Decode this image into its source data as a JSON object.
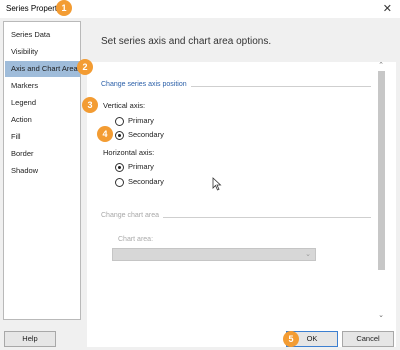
{
  "window": {
    "title": "Series Properties",
    "close_glyph": "✕"
  },
  "sidebar": {
    "items": [
      {
        "label": "Series Data"
      },
      {
        "label": "Visibility"
      },
      {
        "label": "Axis and Chart Area",
        "selected": true
      },
      {
        "label": "Markers"
      },
      {
        "label": "Legend"
      },
      {
        "label": "Action"
      },
      {
        "label": "Fill"
      },
      {
        "label": "Border"
      },
      {
        "label": "Shadow"
      }
    ]
  },
  "content": {
    "header": "Set series axis and chart area options.",
    "axis_section": {
      "title": "Change series axis position",
      "vertical": {
        "label": "Vertical axis:",
        "options": [
          "Primary",
          "Secondary"
        ],
        "selected": "Secondary"
      },
      "horizontal": {
        "label": "Horizontal axis:",
        "options": [
          "Primary",
          "Secondary"
        ],
        "selected": "Primary"
      }
    },
    "chart_area_section": {
      "title": "Change chart area",
      "field_label": "Chart area:",
      "value": ""
    }
  },
  "footer": {
    "help_label": "Help",
    "ok_label": "OK",
    "cancel_label": "Cancel"
  },
  "annotations": [
    "1",
    "2",
    "3",
    "4",
    "5"
  ],
  "colors": {
    "selected_item": "#9fbcda",
    "section_title": "#2a5fa8",
    "badge": "#f39c33",
    "default_button_border": "#3c7fd0"
  }
}
